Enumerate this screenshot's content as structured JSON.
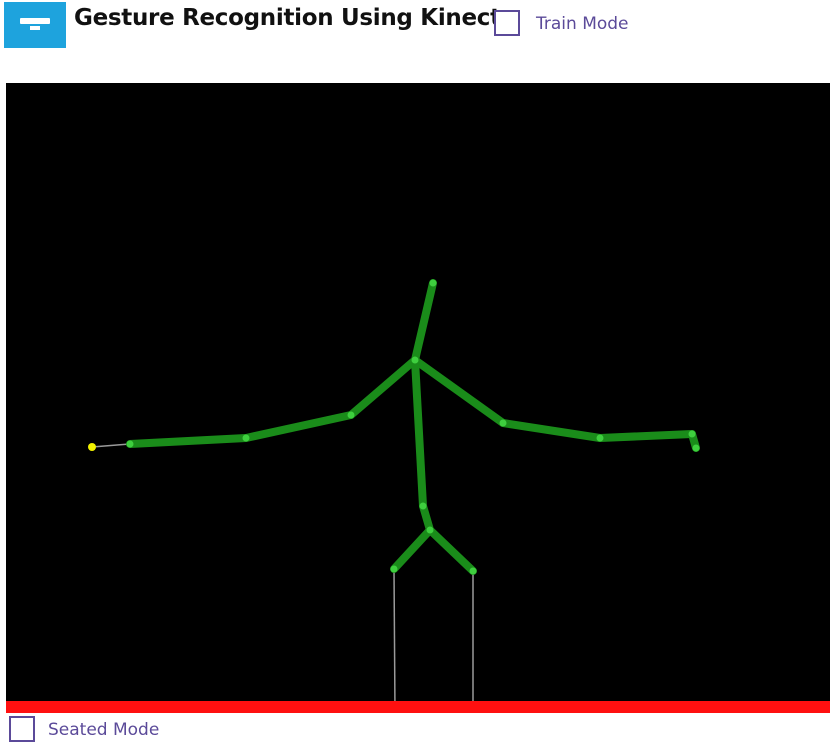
{
  "header": {
    "logo_icon": "kinect-sensor-icon",
    "title": "Gesture Recognition Using Kinect",
    "train_mode": {
      "label": "Train Mode",
      "checked": false
    }
  },
  "skeleton_view": {
    "background": "#000000",
    "bone_color": "#1a8c1a",
    "joint_color": "#3ecf3e",
    "inferred_bone_color": "#9a9a9a",
    "hand_highlight_color": "#f2f200",
    "clip_indicator_color": "#ff1010"
  },
  "footer": {
    "seated_mode": {
      "label": "Seated Mode",
      "checked": false
    }
  }
}
